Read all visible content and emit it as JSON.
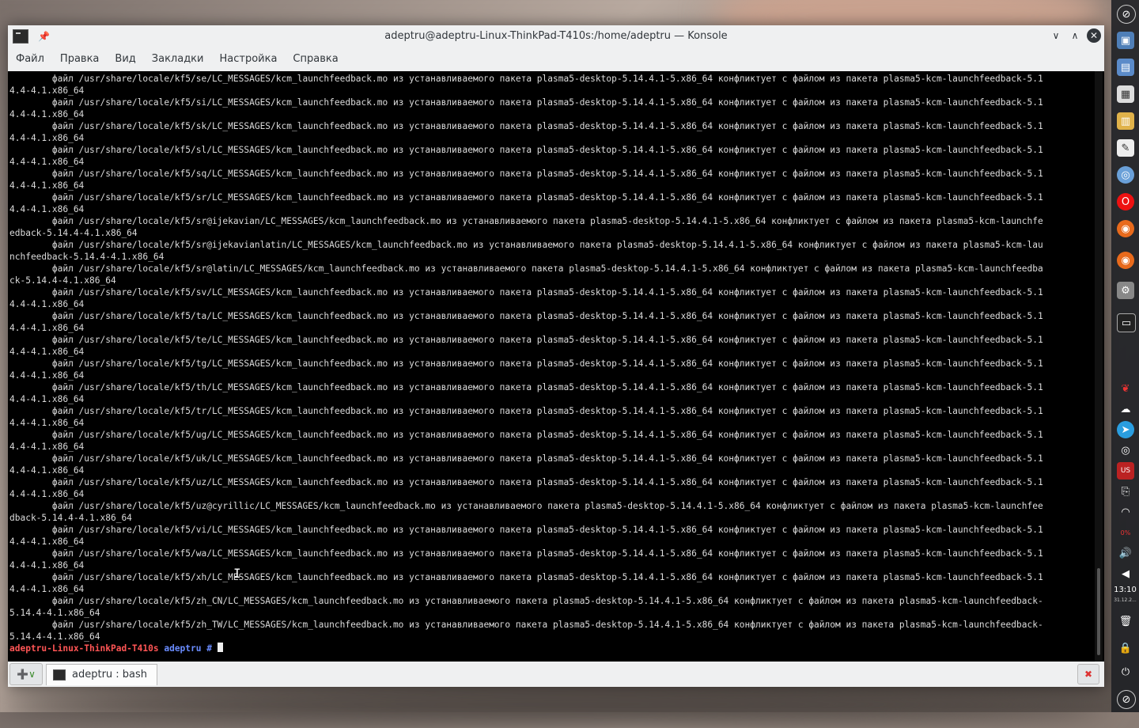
{
  "window": {
    "title": "adeptru@adeptru-Linux-ThinkPad-T410s:/home/adeptru — Konsole"
  },
  "menu": [
    "Файл",
    "Правка",
    "Вид",
    "Закладки",
    "Настройка",
    "Справка"
  ],
  "terminal": {
    "lines": [
      "        файл /usr/share/locale/kf5/se/LC_MESSAGES/kcm_launchfeedback.mo из устанавливаемого пакета plasma5-desktop-5.14.4.1-5.x86_64 конфликтует с файлом из пакета plasma5-kcm-launchfeedback-5.1",
      "4.4-4.1.x86_64",
      "        файл /usr/share/locale/kf5/si/LC_MESSAGES/kcm_launchfeedback.mo из устанавливаемого пакета plasma5-desktop-5.14.4.1-5.x86_64 конфликтует с файлом из пакета plasma5-kcm-launchfeedback-5.1",
      "4.4-4.1.x86_64",
      "        файл /usr/share/locale/kf5/sk/LC_MESSAGES/kcm_launchfeedback.mo из устанавливаемого пакета plasma5-desktop-5.14.4.1-5.x86_64 конфликтует с файлом из пакета plasma5-kcm-launchfeedback-5.1",
      "4.4-4.1.x86_64",
      "        файл /usr/share/locale/kf5/sl/LC_MESSAGES/kcm_launchfeedback.mo из устанавливаемого пакета plasma5-desktop-5.14.4.1-5.x86_64 конфликтует с файлом из пакета plasma5-kcm-launchfeedback-5.1",
      "4.4-4.1.x86_64",
      "        файл /usr/share/locale/kf5/sq/LC_MESSAGES/kcm_launchfeedback.mo из устанавливаемого пакета plasma5-desktop-5.14.4.1-5.x86_64 конфликтует с файлом из пакета plasma5-kcm-launchfeedback-5.1",
      "4.4-4.1.x86_64",
      "        файл /usr/share/locale/kf5/sr/LC_MESSAGES/kcm_launchfeedback.mo из устанавливаемого пакета plasma5-desktop-5.14.4.1-5.x86_64 конфликтует с файлом из пакета plasma5-kcm-launchfeedback-5.1",
      "4.4-4.1.x86_64",
      "        файл /usr/share/locale/kf5/sr@ijekavian/LC_MESSAGES/kcm_launchfeedback.mo из устанавливаемого пакета plasma5-desktop-5.14.4.1-5.x86_64 конфликтует с файлом из пакета plasma5-kcm-launchfe",
      "edback-5.14.4-4.1.x86_64",
      "        файл /usr/share/locale/kf5/sr@ijekavianlatin/LC_MESSAGES/kcm_launchfeedback.mo из устанавливаемого пакета plasma5-desktop-5.14.4.1-5.x86_64 конфликтует с файлом из пакета plasma5-kcm-lau",
      "nchfeedback-5.14.4-4.1.x86_64",
      "        файл /usr/share/locale/kf5/sr@latin/LC_MESSAGES/kcm_launchfeedback.mo из устанавливаемого пакета plasma5-desktop-5.14.4.1-5.x86_64 конфликтует с файлом из пакета plasma5-kcm-launchfeedba",
      "ck-5.14.4-4.1.x86_64",
      "        файл /usr/share/locale/kf5/sv/LC_MESSAGES/kcm_launchfeedback.mo из устанавливаемого пакета plasma5-desktop-5.14.4.1-5.x86_64 конфликтует с файлом из пакета plasma5-kcm-launchfeedback-5.1",
      "4.4-4.1.x86_64",
      "        файл /usr/share/locale/kf5/ta/LC_MESSAGES/kcm_launchfeedback.mo из устанавливаемого пакета plasma5-desktop-5.14.4.1-5.x86_64 конфликтует с файлом из пакета plasma5-kcm-launchfeedback-5.1",
      "4.4-4.1.x86_64",
      "        файл /usr/share/locale/kf5/te/LC_MESSAGES/kcm_launchfeedback.mo из устанавливаемого пакета plasma5-desktop-5.14.4.1-5.x86_64 конфликтует с файлом из пакета plasma5-kcm-launchfeedback-5.1",
      "4.4-4.1.x86_64",
      "        файл /usr/share/locale/kf5/tg/LC_MESSAGES/kcm_launchfeedback.mo из устанавливаемого пакета plasma5-desktop-5.14.4.1-5.x86_64 конфликтует с файлом из пакета plasma5-kcm-launchfeedback-5.1",
      "4.4-4.1.x86_64",
      "        файл /usr/share/locale/kf5/th/LC_MESSAGES/kcm_launchfeedback.mo из устанавливаемого пакета plasma5-desktop-5.14.4.1-5.x86_64 конфликтует с файлом из пакета plasma5-kcm-launchfeedback-5.1",
      "4.4-4.1.x86_64",
      "        файл /usr/share/locale/kf5/tr/LC_MESSAGES/kcm_launchfeedback.mo из устанавливаемого пакета plasma5-desktop-5.14.4.1-5.x86_64 конфликтует с файлом из пакета plasma5-kcm-launchfeedback-5.1",
      "4.4-4.1.x86_64",
      "        файл /usr/share/locale/kf5/ug/LC_MESSAGES/kcm_launchfeedback.mo из устанавливаемого пакета plasma5-desktop-5.14.4.1-5.x86_64 конфликтует с файлом из пакета plasma5-kcm-launchfeedback-5.1",
      "4.4-4.1.x86_64",
      "        файл /usr/share/locale/kf5/uk/LC_MESSAGES/kcm_launchfeedback.mo из устанавливаемого пакета plasma5-desktop-5.14.4.1-5.x86_64 конфликтует с файлом из пакета plasma5-kcm-launchfeedback-5.1",
      "4.4-4.1.x86_64",
      "        файл /usr/share/locale/kf5/uz/LC_MESSAGES/kcm_launchfeedback.mo из устанавливаемого пакета plasma5-desktop-5.14.4.1-5.x86_64 конфликтует с файлом из пакета plasma5-kcm-launchfeedback-5.1",
      "4.4-4.1.x86_64",
      "        файл /usr/share/locale/kf5/uz@cyrillic/LC_MESSAGES/kcm_launchfeedback.mo из устанавливаемого пакета plasma5-desktop-5.14.4.1-5.x86_64 конфликтует с файлом из пакета plasma5-kcm-launchfee",
      "dback-5.14.4-4.1.x86_64",
      "        файл /usr/share/locale/kf5/vi/LC_MESSAGES/kcm_launchfeedback.mo из устанавливаемого пакета plasma5-desktop-5.14.4.1-5.x86_64 конфликтует с файлом из пакета plasma5-kcm-launchfeedback-5.1",
      "4.4-4.1.x86_64",
      "        файл /usr/share/locale/kf5/wa/LC_MESSAGES/kcm_launchfeedback.mo из устанавливаемого пакета plasma5-desktop-5.14.4.1-5.x86_64 конфликтует с файлом из пакета plasma5-kcm-launchfeedback-5.1",
      "4.4-4.1.x86_64",
      "        файл /usr/share/locale/kf5/xh/LC_MESSAGES/kcm_launchfeedback.mo из устанавливаемого пакета plasma5-desktop-5.14.4.1-5.x86_64 конфликтует с файлом из пакета plasma5-kcm-launchfeedback-5.1",
      "4.4-4.1.x86_64",
      "        файл /usr/share/locale/kf5/zh_CN/LC_MESSAGES/kcm_launchfeedback.mo из устанавливаемого пакета plasma5-desktop-5.14.4.1-5.x86_64 конфликтует с файлом из пакета plasma5-kcm-launchfeedback-",
      "5.14.4-4.1.x86_64",
      "        файл /usr/share/locale/kf5/zh_TW/LC_MESSAGES/kcm_launchfeedback.mo из устанавливаемого пакета plasma5-desktop-5.14.4.1-5.x86_64 конфликтует с файлом из пакета plasma5-kcm-launchfeedback-",
      "5.14.4-4.1.x86_64"
    ],
    "prompt": {
      "host": "adeptru-Linux-ThinkPad-T410s",
      "dir": "adeptru",
      "symbol": "#"
    }
  },
  "tabs": [
    {
      "label": "adeptru : bash"
    }
  ],
  "tray": {
    "time": "13:10",
    "date": "31.12.2...",
    "battery_pct": "0%"
  },
  "colors": {
    "prompt_host": "#ff5555",
    "prompt_dir": "#6a8cff",
    "terminal_bg": "#000000",
    "terminal_fg": "#dcdcdc"
  }
}
